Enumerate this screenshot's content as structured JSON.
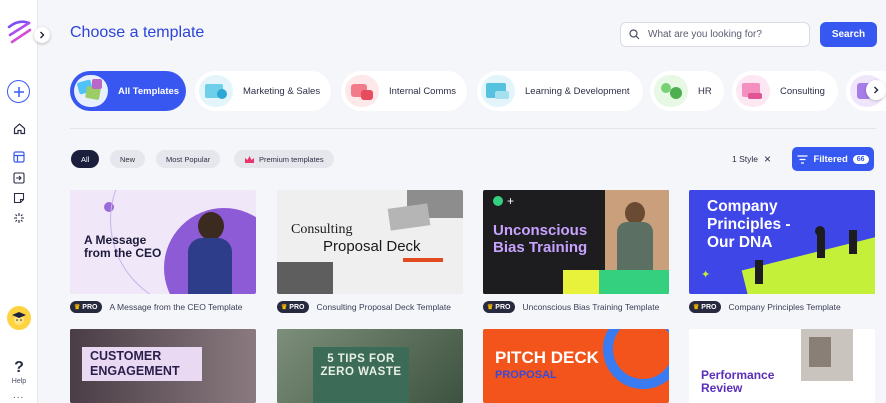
{
  "page": {
    "title": "Choose a template"
  },
  "sidebar": {
    "help_label": "Help",
    "more": "..."
  },
  "search": {
    "placeholder": "What are you looking for?",
    "button": "Search"
  },
  "categories": [
    {
      "label": "All Templates",
      "active": true
    },
    {
      "label": "Marketing & Sales"
    },
    {
      "label": "Internal Comms"
    },
    {
      "label": "Learning & Development"
    },
    {
      "label": "HR"
    },
    {
      "label": "Consulting"
    }
  ],
  "filters": {
    "chips": [
      "All",
      "New",
      "Most Popular",
      "Premium templates"
    ],
    "style_label": "1 Style",
    "style_clear": "×",
    "filtered_label": "Filtered",
    "filtered_count": "66"
  },
  "badge": {
    "pro": "PRO"
  },
  "cards": [
    {
      "title": "A Message from the CEO Template",
      "preview_text": "A Message from the CEO"
    },
    {
      "title": "Consulting Proposal Deck Template",
      "preview_line1": "Consulting",
      "preview_line2": "Proposal Deck"
    },
    {
      "title": "Unconscious Bias Training Template",
      "preview_text": "Unconscious Bias Training"
    },
    {
      "title": "Company Principles Template",
      "preview_text": "Company Principles - Our DNA"
    }
  ],
  "bottom_cards": [
    {
      "preview_text": "CUSTOMER ENGAGEMENT"
    },
    {
      "preview_text": "5 TIPS FOR ZERO WASTE"
    },
    {
      "preview_line1": "PITCH DECK",
      "preview_line2": "PROPOSAL"
    },
    {
      "preview_text": "Performance Review"
    }
  ],
  "colors": {
    "accent": "#3758f0",
    "title": "#2d44d8",
    "sidebar_bg": "#ffffff",
    "page_bg": "#f5f6fa"
  }
}
